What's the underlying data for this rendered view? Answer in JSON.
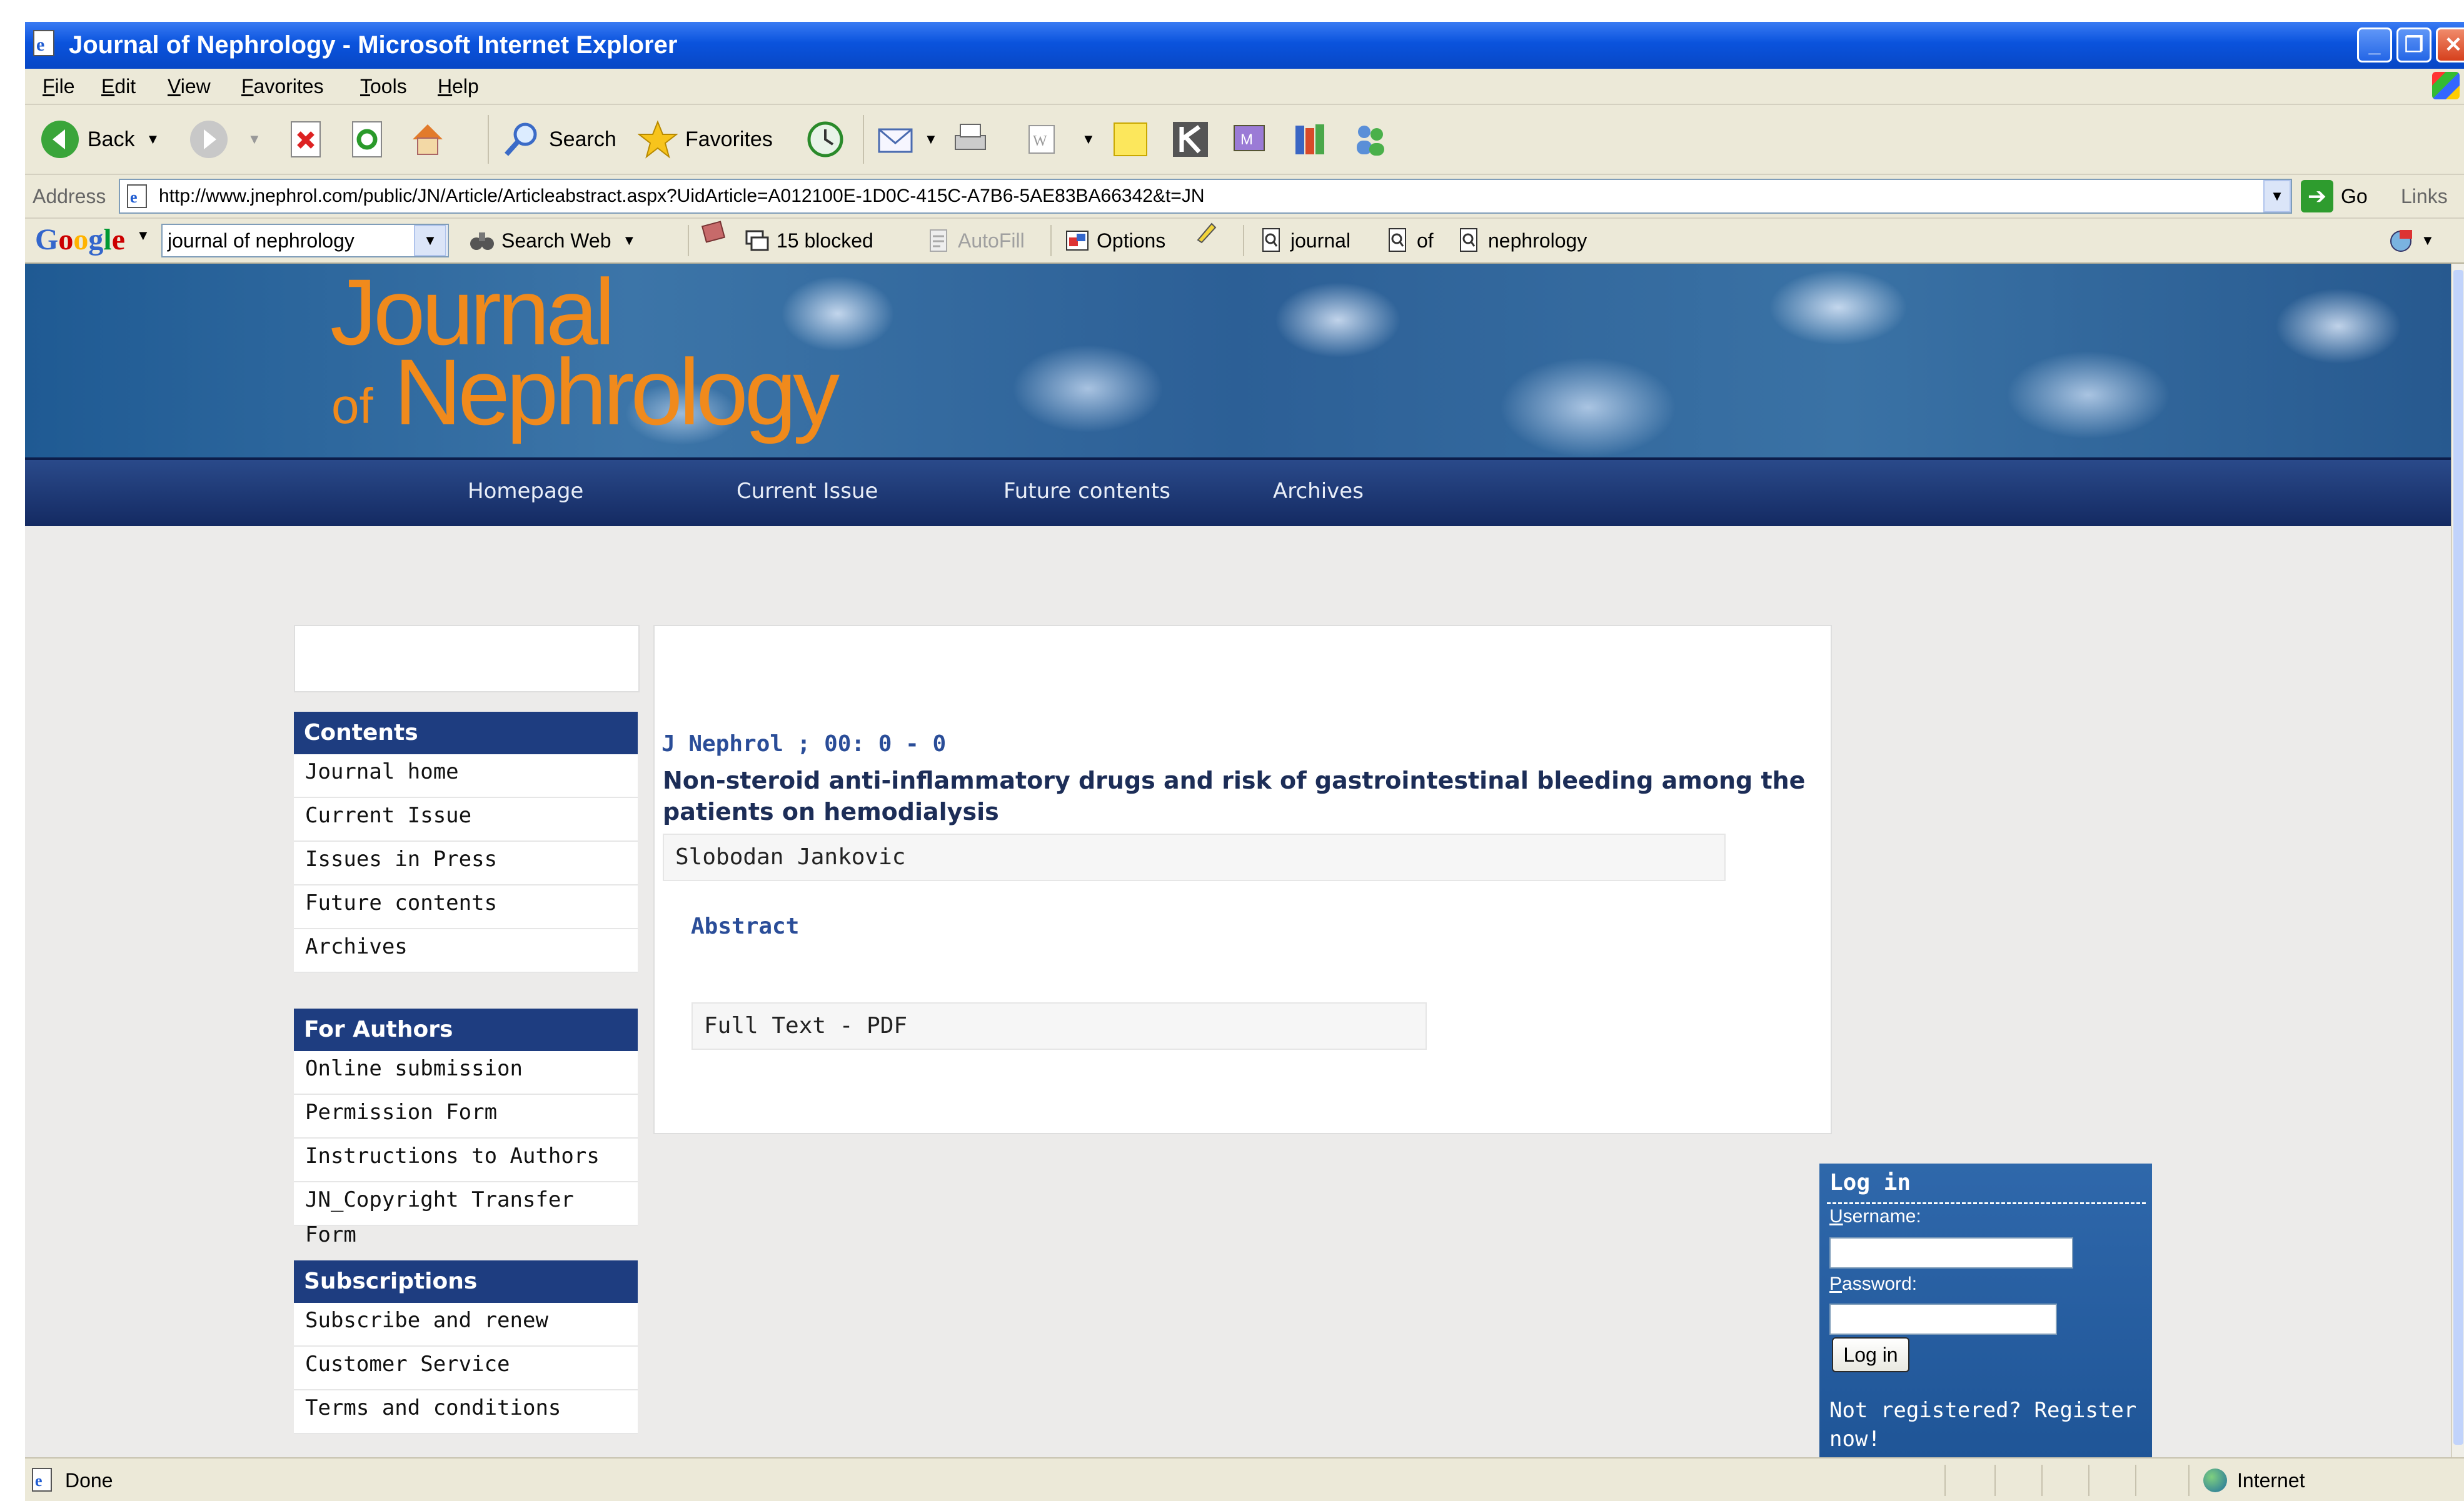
{
  "window": {
    "title": "Journal of Nephrology - Microsoft Internet Explorer"
  },
  "menu": [
    "File",
    "Edit",
    "View",
    "Favorites",
    "Tools",
    "Help"
  ],
  "toolbar": {
    "back": "Back",
    "search": "Search",
    "favorites": "Favorites"
  },
  "address": {
    "label": "Address",
    "url": "http://www.jnephrol.com/public/JN/Article/Articleabstract.aspx?UidArticle=A012100E-1D0C-415C-A7B6-5AE83BA66342&t=JN",
    "go": "Go",
    "links": "Links"
  },
  "google": {
    "logo": "Google",
    "query": "journal of nephrology",
    "search_web": "Search Web",
    "blocked": "15 blocked",
    "autofill": "AutoFill",
    "options": "Options",
    "term1": "journal",
    "term2": "of",
    "term3": "nephrology"
  },
  "site": {
    "logo_line1": "Journal",
    "logo_of": "of",
    "logo_line2": "Nephrology",
    "nav": [
      "Homepage",
      "Current Issue",
      "Future contents",
      "Archives"
    ]
  },
  "sidebar": {
    "contents_head": "Contents",
    "contents": [
      "Journal home",
      "Current Issue",
      "Issues in Press",
      "Future contents",
      "Archives"
    ],
    "authors_head": "For Authors",
    "authors": [
      "Online submission",
      "Permission Form",
      "Instructions to Authors",
      "JN_Copyright Transfer Form"
    ],
    "subs_head": "Subscriptions",
    "subs": [
      "Subscribe and renew",
      "Customer Service",
      "Terms and conditions"
    ]
  },
  "article": {
    "ref": "J Nephrol ; 00: 0 - 0",
    "title": "Non-steroid anti-inflammatory drugs and risk of gastrointestinal bleeding among the patients on hemodialysis",
    "author": "Slobodan Jankovic",
    "abstract": "Abstract",
    "fulltext": "Full Text - PDF"
  },
  "login": {
    "title": "Log in",
    "username_label": "Username:",
    "password_label": "Password:",
    "button": "Log in",
    "register": "Not registered? Register now!"
  },
  "status": {
    "text": "Done",
    "zone": "Internet"
  }
}
